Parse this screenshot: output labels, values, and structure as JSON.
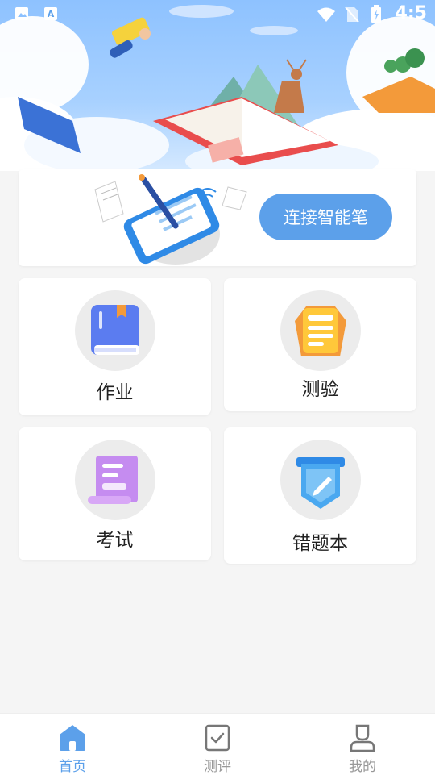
{
  "status_bar": {
    "time": "4:5"
  },
  "pen_card": {
    "connect_label": "连接智能笔"
  },
  "tiles": [
    {
      "label": "作业",
      "icon": "homework-book-icon"
    },
    {
      "label": "测验",
      "icon": "quiz-clipboard-icon"
    },
    {
      "label": "考试",
      "icon": "exam-scroll-icon"
    },
    {
      "label": "错题本",
      "icon": "mistake-notebook-icon"
    }
  ],
  "bottom_nav": {
    "items": [
      {
        "label": "首页",
        "icon": "home-icon",
        "active": true
      },
      {
        "label": "测评",
        "icon": "checkbox-icon",
        "active": false
      },
      {
        "label": "我的",
        "icon": "user-icon",
        "active": false
      }
    ]
  },
  "colors": {
    "accent": "#5ca0ea",
    "nav_active": "#5ca0ea",
    "nav_inactive": "#999999",
    "tile_bg": "#ffffff",
    "page_bg": "#f5f5f5"
  }
}
